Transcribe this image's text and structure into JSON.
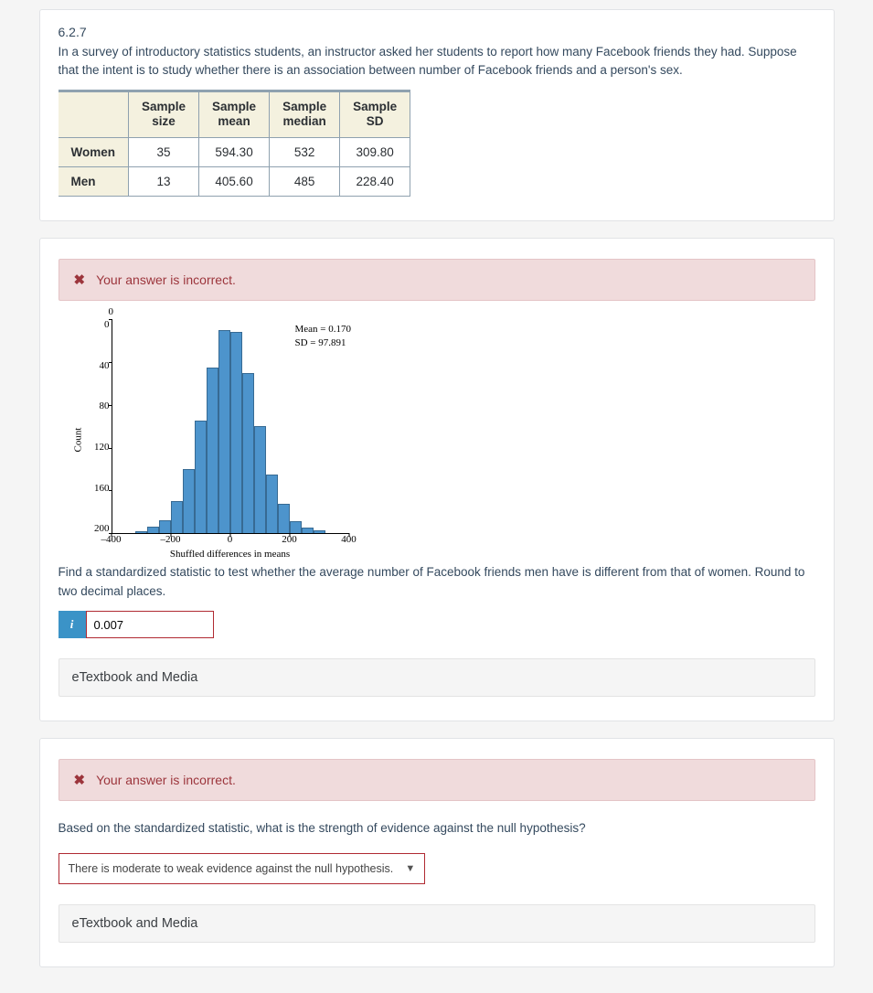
{
  "question": {
    "number": "6.2.7",
    "text": "In a survey of introductory statistics students, an instructor asked her students to report how many Facebook friends they had. Suppose that the intent is to study whether there is an association between number of Facebook friends and a person's sex."
  },
  "table": {
    "headers": [
      "",
      "Sample size",
      "Sample mean",
      "Sample median",
      "Sample SD"
    ],
    "rows": [
      {
        "label": "Women",
        "cells": [
          "35",
          "594.30",
          "532",
          "309.80"
        ]
      },
      {
        "label": "Men",
        "cells": [
          "13",
          "405.60",
          "485",
          "228.40"
        ]
      }
    ]
  },
  "feedback": {
    "text": "Your answer is incorrect."
  },
  "part2": {
    "prompt": "Find a standardized statistic to test whether the average number of Facebook friends men have is different from that of women. Round to two decimal places.",
    "hint_label": "i",
    "input_value": "0.007"
  },
  "resource": {
    "label": "eTextbook and Media"
  },
  "part3": {
    "prompt": "Based on the standardized statistic, what is the strength of evidence against the null hypothesis?",
    "selected": "There is moderate to weak evidence against the null hypothesis."
  },
  "chart_data": {
    "type": "bar",
    "title": "",
    "xlabel": "Shuffled differences in means",
    "ylabel": "Count",
    "xlim": [
      -400,
      400
    ],
    "ylim_display": [
      200,
      0
    ],
    "x_ticks": [
      -400,
      -200,
      0,
      200,
      400
    ],
    "y_ticks": [
      0,
      40,
      80,
      120,
      160,
      200
    ],
    "annotations": {
      "zero": "0",
      "mean_line": "Mean = 0.170",
      "sd_line": "SD = 97.891"
    },
    "bin_width": 40,
    "categories": [
      -380,
      -340,
      -300,
      -260,
      -220,
      -180,
      -140,
      -100,
      -60,
      -20,
      20,
      60,
      100,
      140,
      180,
      220,
      260,
      300,
      340,
      380
    ],
    "values": [
      0,
      0,
      2,
      6,
      12,
      30,
      60,
      105,
      155,
      190,
      188,
      150,
      100,
      55,
      28,
      11,
      5,
      3,
      0,
      0
    ]
  }
}
